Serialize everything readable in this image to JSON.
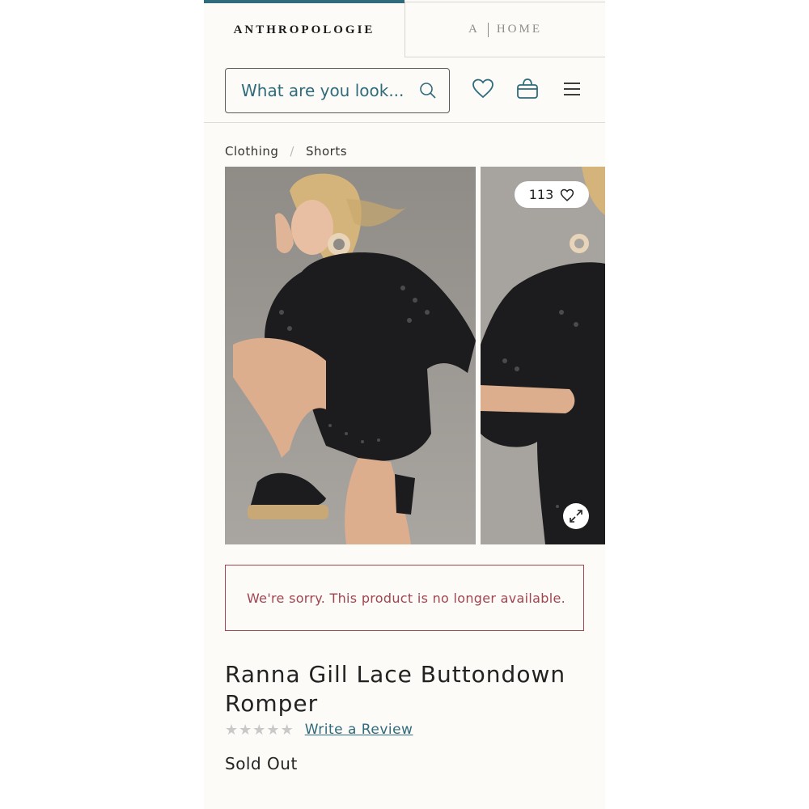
{
  "brand_tabs": {
    "primary": "ANTHROPOLOGIE",
    "home_prefix": "A",
    "home_label": "HOME"
  },
  "header": {
    "search_placeholder": "What are you look..."
  },
  "breadcrumb": [
    "Clothing",
    "Shorts"
  ],
  "gallery": {
    "wishlist_count": "113",
    "image_count": 4,
    "active_index": 0
  },
  "notice": "We're sorry. This product is no longer available.",
  "product": {
    "title": "Ranna Gill Lace Buttondown Romper",
    "rating_stars": 0,
    "rating_max": 5,
    "review_link": "Write a Review",
    "availability": "Sold Out"
  },
  "colors": {
    "accent": "#2f6b7c",
    "error": "#a24450",
    "background": "#fcfbf7"
  }
}
